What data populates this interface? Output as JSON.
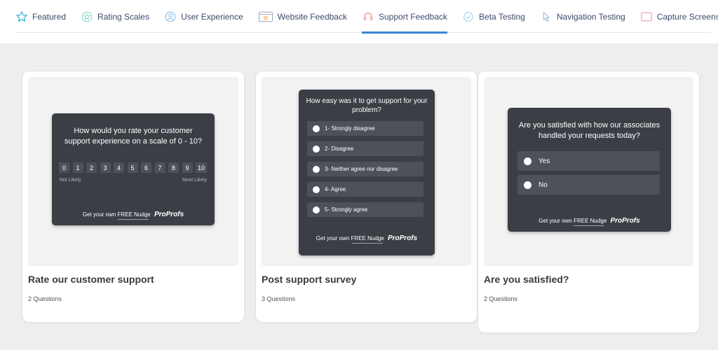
{
  "tabs": [
    {
      "label": "Featured",
      "icon": "star-icon"
    },
    {
      "label": "Rating Scales",
      "icon": "star-badge-icon"
    },
    {
      "label": "User Experience",
      "icon": "user-smile-icon"
    },
    {
      "label": "Website Feedback",
      "icon": "browser-star-icon"
    },
    {
      "label": "Support Feedback",
      "icon": "headset-icon",
      "active": true
    },
    {
      "label": "Beta Testing",
      "icon": "check-circle-icon"
    },
    {
      "label": "Navigation Testing",
      "icon": "pointer-icon"
    },
    {
      "label": "Capture Screenshot",
      "icon": "screenshot-icon"
    }
  ],
  "colors": {
    "accent": "#3d86d6",
    "widget_bg": "#3b3e45",
    "option_bg": "#4d515a",
    "page_bg": "#eeeeee"
  },
  "cards": [
    {
      "title": "Rate our customer support",
      "subtitle": "2 Questions",
      "widget": {
        "question_line1": "How would you rate your customer",
        "question_line2": "support experience on a scale of 0 - 10?",
        "scale": [
          "0",
          "1",
          "2",
          "3",
          "4",
          "5",
          "6",
          "7",
          "8",
          "9",
          "10"
        ],
        "label_low": "Not Likely",
        "label_high": "Most Likely"
      }
    },
    {
      "title": "Post support survey",
      "subtitle": "3 Questions",
      "widget": {
        "question_line1": "How easy was it to get support for your",
        "question_line2": "problem?",
        "options": [
          "1- Strongly disagree",
          "2- Disagree",
          "3- Neither agree nor disagree",
          "4- Agree",
          "5- Strongly agree"
        ]
      }
    },
    {
      "title": "Are you satisfied?",
      "subtitle": "2 Questions",
      "widget": {
        "question_line1": "Are you satisfied with how our associates",
        "question_line2": "handled your requests today?",
        "options": [
          "Yes",
          "No"
        ]
      }
    }
  ],
  "footer": {
    "prefix": "Get your own",
    "free": "FREE Nudge",
    "brand": "ProProfs"
  }
}
